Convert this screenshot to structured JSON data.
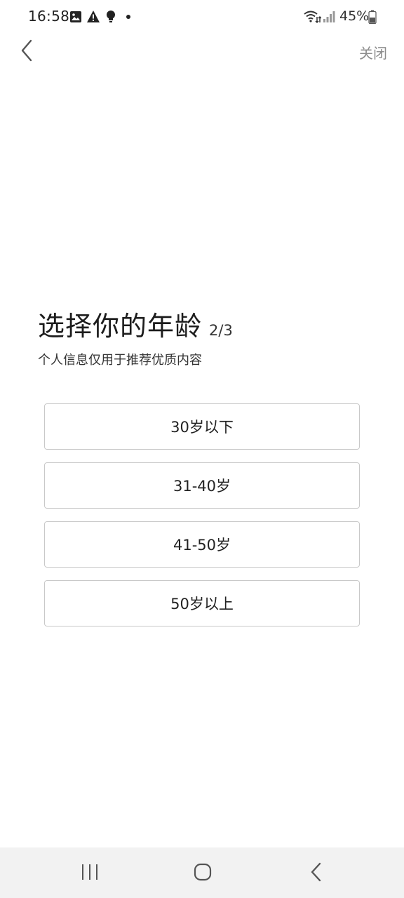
{
  "status_bar": {
    "time": "16:58",
    "battery": "45%",
    "icons": [
      "gallery-icon",
      "warning-icon",
      "bulb-icon",
      "dot-icon",
      "wifi-icon",
      "signal-icon",
      "battery-icon"
    ]
  },
  "header": {
    "back_icon": "chevron-left-icon",
    "close_label": "关闭"
  },
  "content": {
    "title": "选择你的年龄",
    "step": "2/3",
    "subtitle": "个人信息仅用于推荐优质内容",
    "options": [
      {
        "label": "30岁以下"
      },
      {
        "label": "31-40岁"
      },
      {
        "label": "41-50岁"
      },
      {
        "label": "50岁以上"
      }
    ]
  },
  "nav_bar": {
    "icons": [
      "recent-apps-icon",
      "home-icon",
      "back-icon"
    ]
  }
}
